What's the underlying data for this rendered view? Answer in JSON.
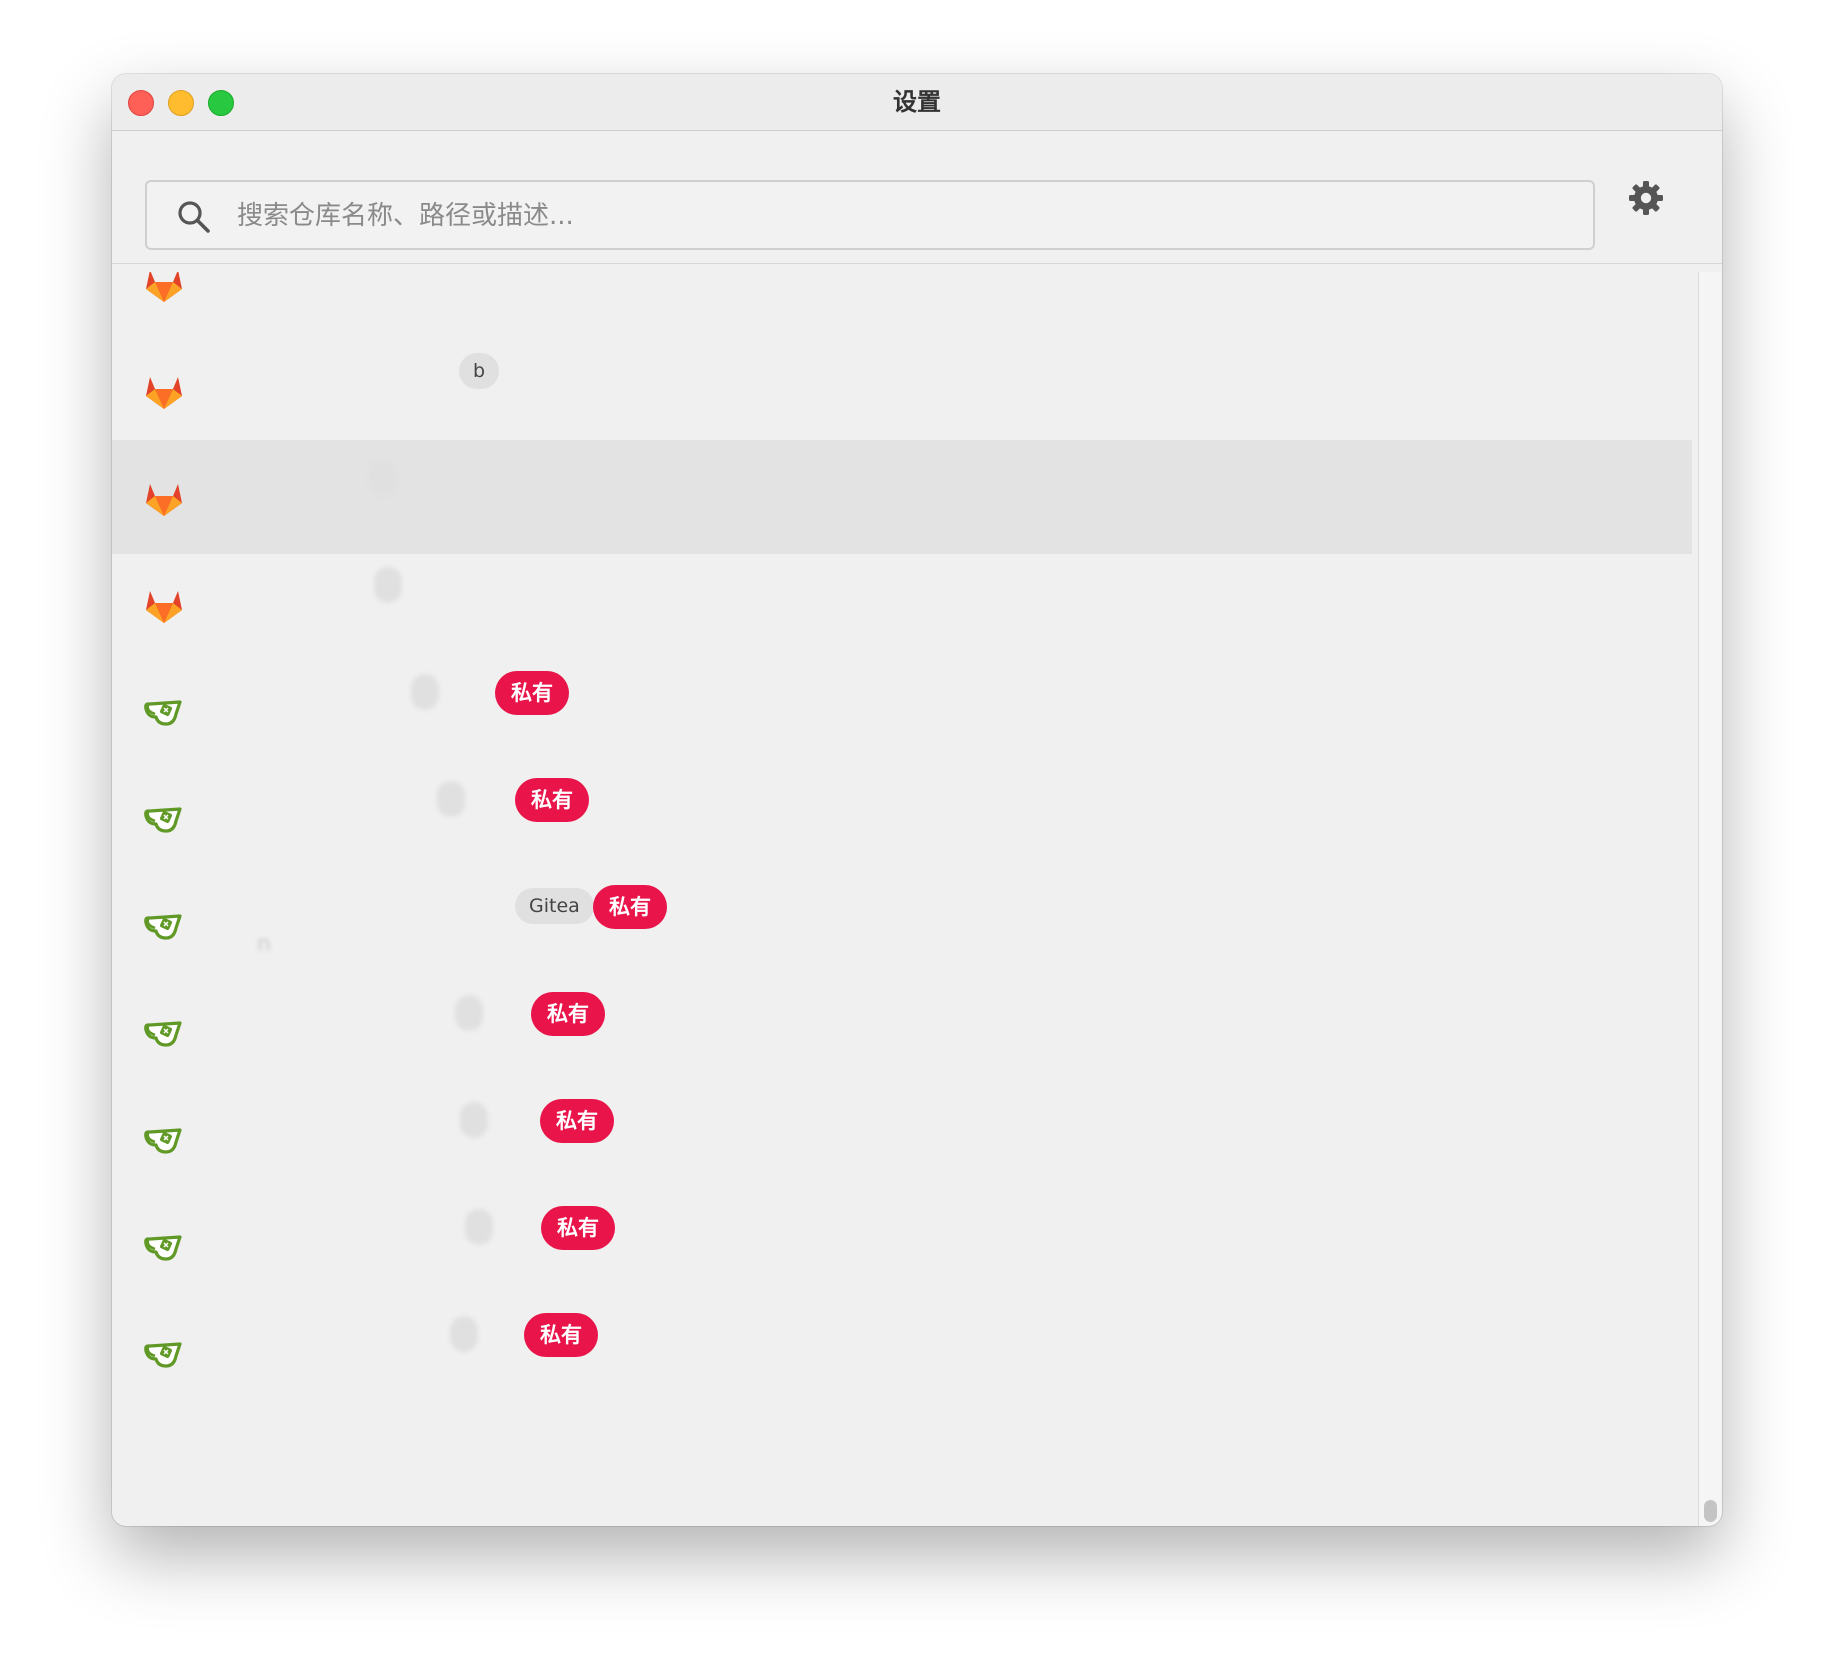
{
  "window": {
    "title": "设置"
  },
  "search": {
    "placeholder": "搜索仓库名称、路径或描述..."
  },
  "icons": {
    "search": "search-icon",
    "settings": "gear-icon",
    "gitlab": "gitlab-icon",
    "gitea": "gitea-icon"
  },
  "colors": {
    "private_badge": "#e8144a",
    "gitlab_orange": "#fc6d26",
    "gitea_green": "#609926"
  },
  "repos": [
    {
      "provider": "gitlab",
      "name": "",
      "path": "",
      "tag": "",
      "private": ""
    },
    {
      "provider": "gitlab",
      "name": "",
      "path": "",
      "tag": "b",
      "private": ""
    },
    {
      "provider": "gitlab",
      "name": "",
      "path": "",
      "tag": "",
      "private": "",
      "selected": true
    },
    {
      "provider": "gitlab",
      "name": "",
      "path": "",
      "tag": "",
      "private": ""
    },
    {
      "provider": "gitea",
      "name": "",
      "path": "",
      "tag": "",
      "private": "私有"
    },
    {
      "provider": "gitea",
      "name": "",
      "path": "",
      "tag": "",
      "private": "私有"
    },
    {
      "provider": "gitea",
      "name": "",
      "path": "n",
      "tag": "Gitea",
      "private": "私有"
    },
    {
      "provider": "gitea",
      "name": "",
      "path": "",
      "tag": "",
      "private": "私有"
    },
    {
      "provider": "gitea",
      "name": "",
      "path": "",
      "tag": "",
      "private": "私有"
    },
    {
      "provider": "gitea",
      "name": "",
      "path": "",
      "tag": "",
      "private": "私有"
    },
    {
      "provider": "gitea",
      "name": "",
      "path": "",
      "tag": "",
      "private": "私有"
    }
  ]
}
